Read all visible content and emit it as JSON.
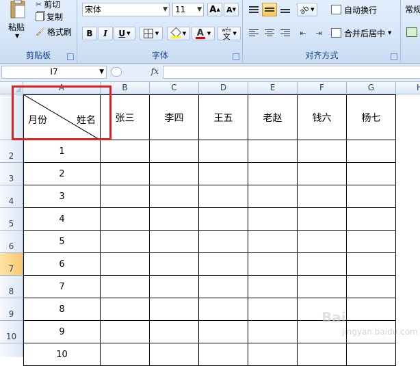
{
  "ribbon": {
    "clipboard": {
      "paste": "粘贴",
      "cut": "剪切",
      "copy": "复制",
      "format_painter": "格式刷",
      "label": "剪贴板"
    },
    "font": {
      "font_name": "宋体",
      "font_size": "11",
      "bold": "B",
      "italic": "I",
      "underline": "U",
      "phonetic": "wén",
      "phonetic_char": "文",
      "font_color_glyph": "A",
      "grow": "A",
      "shrink": "A",
      "label": "字体"
    },
    "alignment": {
      "wrap_text": "自动换行",
      "merge_center": "合并后居中",
      "label": "对齐方式"
    },
    "number": {
      "format": "常规"
    }
  },
  "formula_bar": {
    "name_box": "I7",
    "fx": "fx",
    "formula": ""
  },
  "columns": [
    "A",
    "B",
    "C",
    "D",
    "E",
    "F",
    "G",
    "H"
  ],
  "rows": [
    "",
    "2",
    "3",
    "4",
    "5",
    "6",
    "7",
    "8",
    "9",
    "10",
    ""
  ],
  "header_row": {
    "diag_month": "月份",
    "diag_name": "姓名",
    "names": [
      "张三",
      "李四",
      "王五",
      "老赵",
      "钱六",
      "杨七"
    ]
  },
  "months": [
    "1",
    "2",
    "3",
    "4",
    "5",
    "6",
    "7",
    "8",
    "9",
    "10"
  ],
  "watermark": {
    "brand": "Bai",
    "sub": "jingyan.baidu.com"
  },
  "colors": {
    "highlight": "#e0211f",
    "selected_row": "#f9c770",
    "ribbon": "#d5e5f8"
  }
}
